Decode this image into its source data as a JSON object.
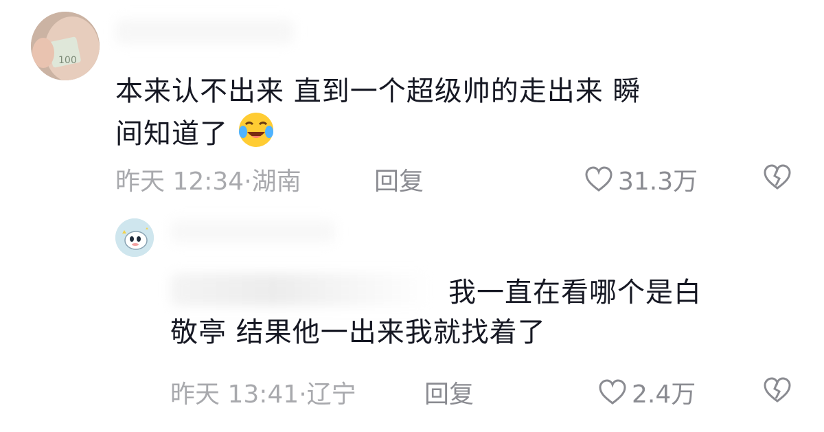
{
  "comments": [
    {
      "text_line1": "本来认不出来 直到一个超级帅的走出来 瞬",
      "text_line2": "间知道了",
      "emoji": "crying-laughing-emoji",
      "timestamp": "昨天 12:34·湖南",
      "reply_label": "回复",
      "likes": "31.3万"
    },
    {
      "text_line1": "我一直在看哪个是白",
      "text_line2": "敬亭 结果他一出来我就找着了",
      "timestamp": "昨天 13:41·辽宁",
      "reply_label": "回复",
      "likes": "2.4万"
    }
  ],
  "icons": {
    "like": "heart-outline-icon",
    "dislike": "broken-heart-icon"
  }
}
